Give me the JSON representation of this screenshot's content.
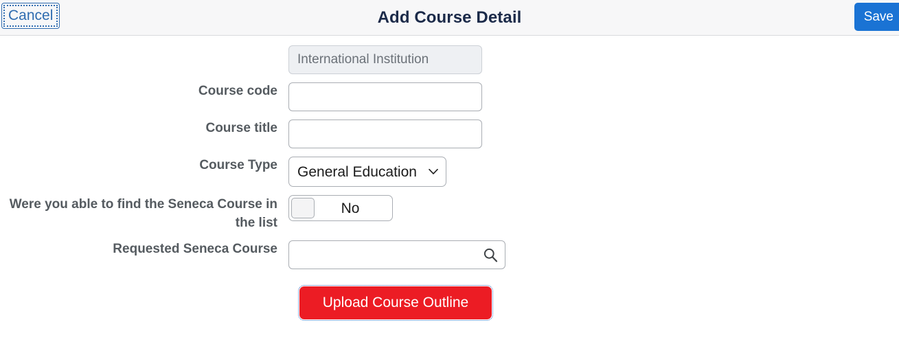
{
  "header": {
    "title": "Add Course Detail",
    "cancel_label": "Cancel",
    "save_label": "Save"
  },
  "form": {
    "institution": {
      "value": "International Institution",
      "placeholder": ""
    },
    "course_code": {
      "label": "Course code",
      "value": "",
      "placeholder": ""
    },
    "course_title": {
      "label": "Course title",
      "value": "",
      "placeholder": ""
    },
    "course_type": {
      "label": "Course Type",
      "selected": "General Education",
      "options": [
        "General Education"
      ]
    },
    "found_seneca_course": {
      "label": "Were you able to find the Seneca Course in the list",
      "toggle_state": "No"
    },
    "requested_seneca_course": {
      "label": "Requested Seneca Course",
      "value": "",
      "placeholder": ""
    },
    "upload_button_label": "Upload Course Outline"
  },
  "colors": {
    "header_bg": "#f7f7f8",
    "title": "#1b2a49",
    "save_blue": "#1a73d4",
    "cancel_blue": "#2f6cb0",
    "label_gray": "#555b60",
    "upload_red": "#ec1c24"
  },
  "icons": {
    "chevron_down": "chevron-down-icon",
    "search": "search-icon"
  }
}
